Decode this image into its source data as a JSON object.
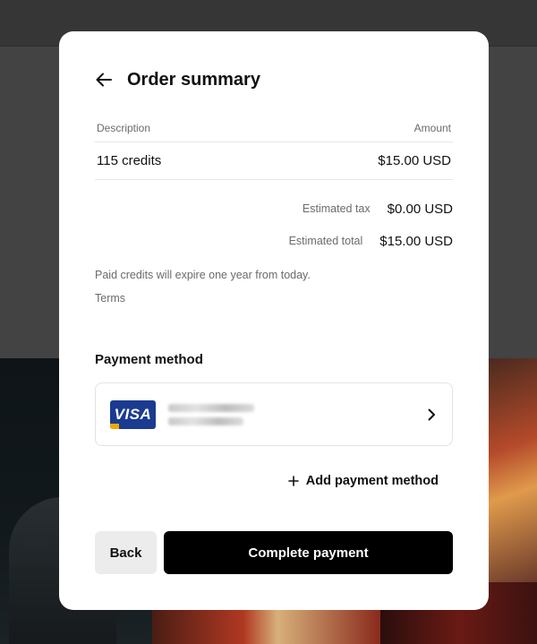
{
  "modal": {
    "title": "Order summary"
  },
  "table": {
    "headers": {
      "description": "Description",
      "amount": "Amount"
    },
    "rows": [
      {
        "description": "115 credits",
        "amount": "$15.00 USD"
      }
    ]
  },
  "summary": {
    "tax_label": "Estimated tax",
    "tax_value": "$0.00 USD",
    "total_label": "Estimated total",
    "total_value": "$15.00 USD"
  },
  "note": "Paid credits will expire one year from today.",
  "terms_link": "Terms",
  "payment": {
    "title": "Payment method",
    "card_brand": "VISA",
    "add_label": "Add payment method"
  },
  "actions": {
    "back_label": "Back",
    "complete_label": "Complete payment"
  },
  "colors": {
    "primary_button": "#000000",
    "secondary_button": "#ececec",
    "visa_blue": "#1a3b8f",
    "muted_text": "#6b6b6b"
  },
  "icons": [
    "arrow-left-icon",
    "chevron-right-icon",
    "plus-icon",
    "visa-logo-icon"
  ]
}
